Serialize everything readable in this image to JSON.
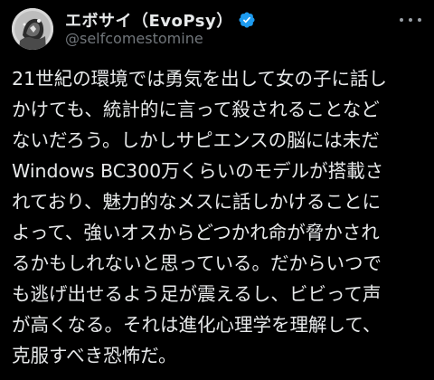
{
  "post": {
    "display_name": "エボサイ（EvoPsy）",
    "handle": "@selfcomestomine",
    "verified": true,
    "body_lines": [
      "21世紀の環境では勇気を出して女の子に話し",
      "かけても、統計的に言って殺されることなど",
      "ないだろう。しかしサピエンスの脳には未だ",
      "Windows BC300万くらいのモデルが搭載さ",
      "れており、魅力的なメスに話しかけることに",
      "よって、強いオスからどつかれ命が脅かされ",
      "るかもしれないと思っている。だからいつで",
      "も逃げ出せるよう足が震えるし、ビビって声",
      "が高くなる。それは進化心理学を理解して、",
      "克服すべき恐怖だ。"
    ]
  },
  "icons": {
    "avatar": "avatar-image",
    "verified": "verified-badge-icon",
    "more": "more-options-icon"
  },
  "colors": {
    "background": "#000000",
    "text_primary": "#e7e9ea",
    "text_secondary": "#71767b",
    "verified_blue": "#1d9bf0"
  }
}
